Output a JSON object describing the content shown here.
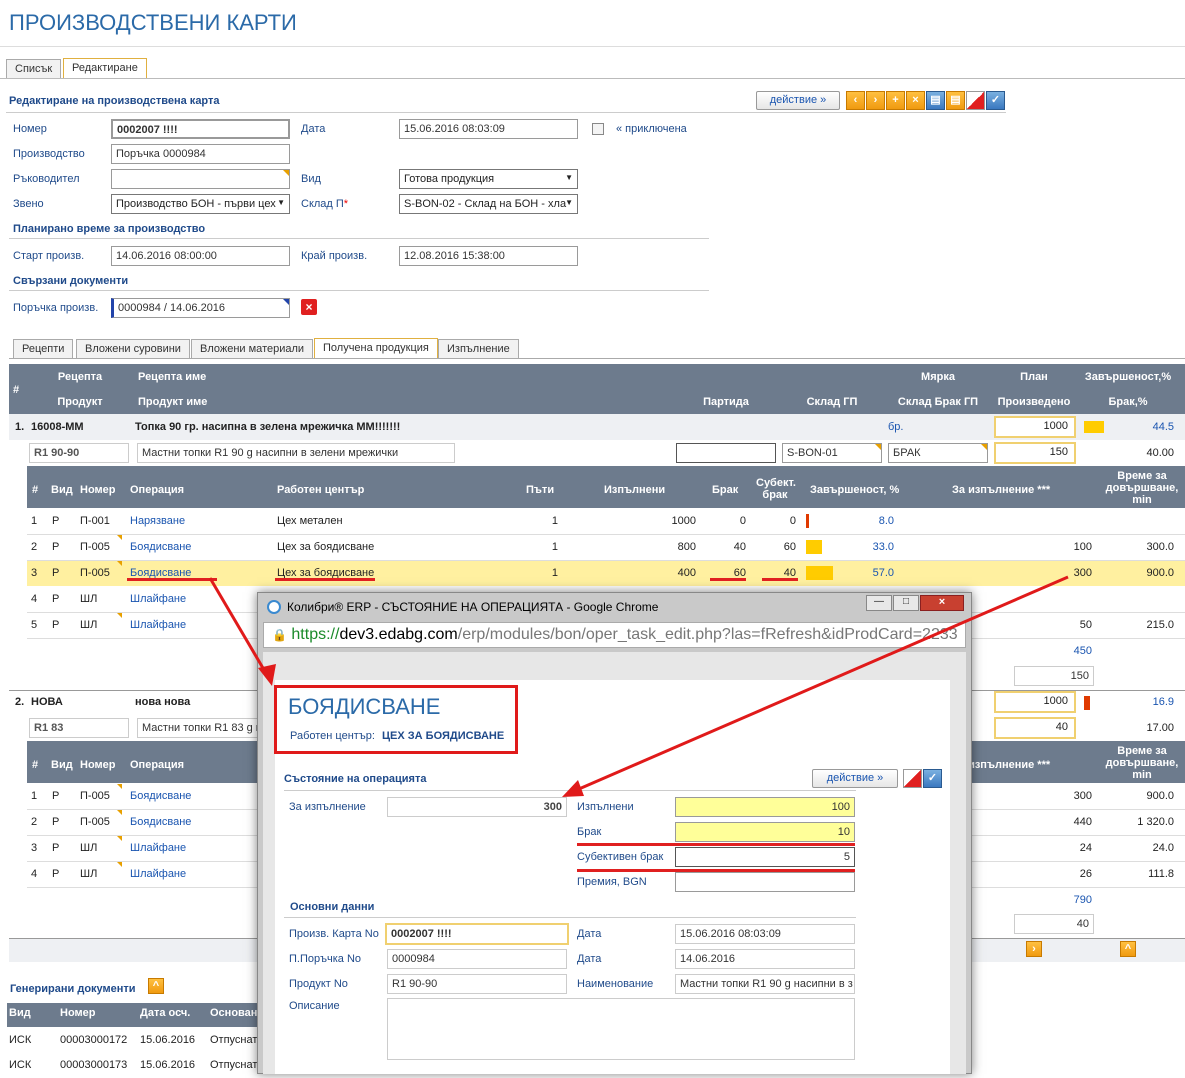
{
  "page": {
    "title": "ПРОИЗВОДСТВЕНИ КАРТИ",
    "tabs": [
      "Списък",
      "Редактиране"
    ],
    "section_title": "Редактиране на производствена карта",
    "action_label": "действие »"
  },
  "form": {
    "nomer_label": "Номер",
    "nomer": "0002007 !!!!",
    "data_label": "Дата",
    "data": "15.06.2016 08:03:09",
    "closed_label": "« приключена",
    "proizvodstvo_label": "Производство",
    "proizvodstvo": "Поръчка 0000984",
    "rakovoditel_label": "Ръководител",
    "rakovoditel": "",
    "vid_label": "Вид",
    "vid": "Готова продукция",
    "zveno_label": "Звено",
    "zveno": "Производство БОН - първи цех",
    "sklad_label": "Склад П",
    "sklad_star": "*",
    "sklad": "S-BON-02 - Склад на БОН - хла",
    "planned_title": "Планирано време за производство",
    "start_label": "Старт произв.",
    "start": "14.06.2016 08:00:00",
    "end_label": "Край произв.",
    "end": "12.08.2016 15:38:00",
    "linked_title": "Свързани документи",
    "order_label": "Поръчка произв.",
    "order": "0000984 / 14.06.2016"
  },
  "subtabs": [
    "Рецепти",
    "Вложени суровини",
    "Вложени материали",
    "Получена продукция",
    "Изпълнение"
  ],
  "grid": {
    "h1": {
      "num": "#",
      "recipe": "Рецепта",
      "recipe_name": "Рецепта име",
      "unit": "Мярка",
      "plan": "План",
      "completion": "Завършеност,%"
    },
    "h2": {
      "product": "Продукт",
      "product_name": "Продукт име",
      "batch": "Партида",
      "store": "Склад ГП",
      "scrap_store": "Склад Брак ГП",
      "produced": "Произведено",
      "scrap_pct": "Брак,%"
    },
    "ops_head": {
      "num": "#",
      "type": "Вид",
      "code": "Номер",
      "op": "Операция",
      "center": "Работен център",
      "times": "Пъти",
      "done": "Изпълнени",
      "scrap": "Брак",
      "subj": "Субект. брак",
      "compl": "Завършеност, %",
      "todo": "За изпълнение ***",
      "time": "Време за довършване, min"
    },
    "r1": {
      "idx": "1.",
      "recipe": "16008-ММ",
      "name": "Топка 90 гр. насипна в зелена мрежичка ММ!!!!!!!",
      "unit": "бр.",
      "plan": "1000",
      "pct": "44.5",
      "product": "R1 90-90",
      "product_name": "Мастни топки R1 90 g насипни в зелени мрежички",
      "batch": "",
      "store": "S-BON-01",
      "scrap_store": "БРАК",
      "produced": "150",
      "scrap_pct": "40.00"
    },
    "ops1": [
      {
        "n": "1",
        "t": "Р",
        "c": "П-001",
        "op": "Нарязване",
        "wc": "Цех метален",
        "x": "1",
        "done": "1000",
        "scrap": "0",
        "subj": "0",
        "pct": "8.0",
        "todo": "",
        "time": ""
      },
      {
        "n": "2",
        "t": "Р",
        "c": "П-005",
        "op": "Боядисване",
        "wc": "Цех за боядисване",
        "x": "1",
        "done": "800",
        "scrap": "40",
        "subj": "60",
        "pct": "33.0",
        "todo": "100",
        "time": "300.0"
      },
      {
        "n": "3",
        "t": "Р",
        "c": "П-005",
        "op": "Боядисване",
        "wc": "Цех за боядисване",
        "x": "1",
        "done": "400",
        "scrap": "60",
        "subj": "40",
        "pct": "57.0",
        "todo": "300",
        "time": "900.0"
      },
      {
        "n": "4",
        "t": "Р",
        "c": "ШЛ",
        "op": "Шлайфане",
        "wc": "",
        "x": "",
        "done": "",
        "scrap": "",
        "subj": "",
        "pct": "",
        "todo": "",
        "time": ""
      },
      {
        "n": "5",
        "t": "Р",
        "c": "ШЛ",
        "op": "Шлайфане",
        "wc": "",
        "x": "",
        "done": "",
        "scrap": "",
        "subj": "",
        "pct": "",
        "todo": "50",
        "time": "215.0"
      }
    ],
    "sum1a": "450",
    "sum1b": "150",
    "r2": {
      "idx": "2.",
      "recipe": "НОВА",
      "name": "нова нова",
      "plan": "1000",
      "pct": "16.9",
      "product": "R1 83",
      "product_name": "Мастни топки R1 83 g н",
      "produced": "40",
      "scrap_pct": "17.00"
    },
    "ops2": [
      {
        "n": "1",
        "t": "Р",
        "c": "П-005",
        "op": "Боядисване",
        "todo": "300",
        "time": "900.0"
      },
      {
        "n": "2",
        "t": "Р",
        "c": "П-005",
        "op": "Боядисване",
        "todo": "440",
        "time": "1 320.0"
      },
      {
        "n": "3",
        "t": "Р",
        "c": "ШЛ",
        "op": "Шлайфане",
        "todo": "24",
        "time": "24.0"
      },
      {
        "n": "4",
        "t": "Р",
        "c": "ШЛ",
        "op": "Шлайфане",
        "todo": "26",
        "time": "111.8"
      }
    ],
    "sum2a": "790",
    "sum2b": "40"
  },
  "generated": {
    "title": "Генерирани документи",
    "cols": [
      "Вид",
      "Номер",
      "Дата осч.",
      "Основание"
    ],
    "rows": [
      [
        "ИСК",
        "00003000172",
        "15.06.2016",
        "Отпусната"
      ],
      [
        "ИСК",
        "00003000173",
        "15.06.2016",
        "Отпусната"
      ]
    ]
  },
  "popup": {
    "window_title": "Колибри® ERP - СЪСТОЯНИЕ НА ОПЕРАЦИЯТА - Google Chrome",
    "url_https": "https://",
    "url_host": "dev3.edabg.com",
    "url_path": "/erp/modules/bon/oper_task_edit.php?las=fRefresh&idProdCard=2233",
    "op_title": "БОЯДИСВАНЕ",
    "wc_label": "Работен център:",
    "wc_value": "ЦЕХ ЗА БОЯДИСВАНЕ",
    "state_title": "Състояние на операцията",
    "action_label": "действие »",
    "todo_label": "За изпълнение",
    "todo": "300",
    "done_label": "Изпълнени",
    "done": "100",
    "scrap_label": "Брак",
    "scrap": "10",
    "subj_label": "Субективен брак",
    "subj": "5",
    "bonus_label": "Премия, BGN",
    "bonus": "",
    "main_title": "Основни данни",
    "card_label": "Произв. Карта No",
    "card": "0002007 !!!!",
    "date1_label": "Дата",
    "date1": "15.06.2016 08:03:09",
    "order_label": "П.Поръчка No",
    "order": "0000984",
    "date2_label": "Дата",
    "date2": "14.06.2016",
    "product_label": "Продукт No",
    "product": "R1 90-90",
    "name_label": "Наименование",
    "name": "Мастни топки R1 90 g насипни в з",
    "desc_label": "Описание",
    "desc": ""
  }
}
